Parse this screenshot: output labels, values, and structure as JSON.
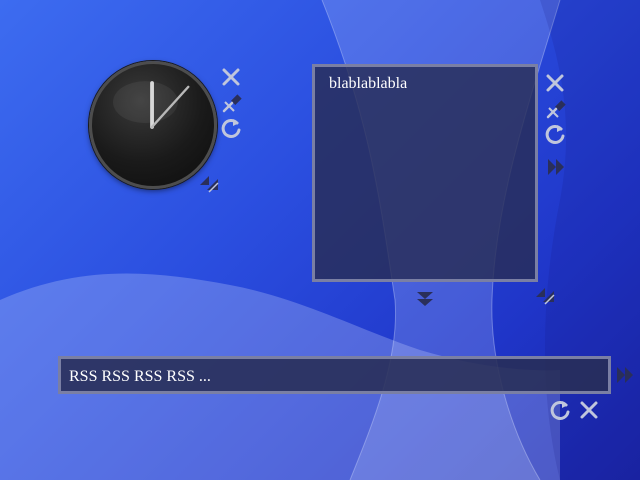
{
  "desktop": {
    "colors": {
      "bg_light": "#3d6cf0",
      "bg_dark": "#1b25a8",
      "panel": "#282d55",
      "panel_border": "#7a7fa4",
      "icon": "#c0c6dc"
    }
  },
  "clock_widget": {
    "hour_hand_angle": 0,
    "minute_hand_angle": 40,
    "controls": [
      "close-icon",
      "pin-icon",
      "refresh-icon",
      "resize-icon"
    ]
  },
  "note_widget": {
    "text": "blablablabla",
    "controls": [
      "close-icon",
      "pin-icon",
      "refresh-icon",
      "forward-icon",
      "collapse-icon",
      "resize-icon"
    ]
  },
  "rss_widget": {
    "text": "RSS RSS RSS RSS ...",
    "controls": [
      "forward-icon",
      "refresh-icon",
      "close-icon"
    ]
  }
}
